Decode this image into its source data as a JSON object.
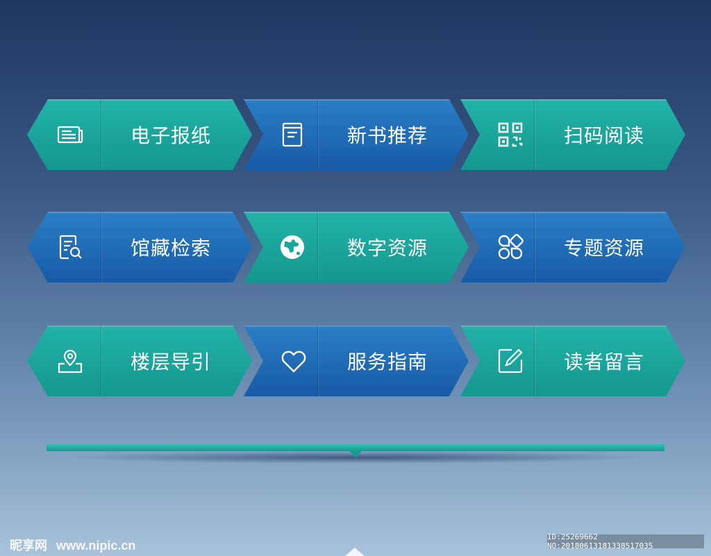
{
  "colors": {
    "teal": "#1aa69d",
    "blue": "#216cb6",
    "text": "#ffffff"
  },
  "tiles": [
    {
      "label": "电子报纸",
      "icon": "newspaper-icon",
      "color": "teal"
    },
    {
      "label": "新书推荐",
      "icon": "book-icon",
      "color": "blue"
    },
    {
      "label": "扫码阅读",
      "icon": "qr-code-icon",
      "color": "teal"
    },
    {
      "label": "馆藏检索",
      "icon": "document-search-icon",
      "color": "blue"
    },
    {
      "label": "数字资源",
      "icon": "globe-icon",
      "color": "teal"
    },
    {
      "label": "专题资源",
      "icon": "grid-shapes-icon",
      "color": "blue"
    },
    {
      "label": "楼层导引",
      "icon": "map-pin-icon",
      "color": "teal"
    },
    {
      "label": "服务指南",
      "icon": "heart-icon",
      "color": "blue"
    },
    {
      "label": "读者留言",
      "icon": "edit-icon",
      "color": "teal"
    }
  ],
  "watermark": {
    "brand": "昵享网",
    "site": "www.nipic.cn",
    "id_text": "ID:25269662 NO:20180613181338517035"
  }
}
